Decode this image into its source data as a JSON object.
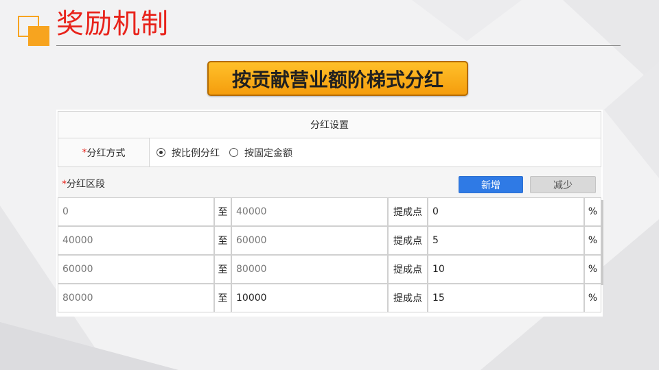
{
  "slide": {
    "title": "奖励机制",
    "banner": "按贡献营业额阶梯式分红"
  },
  "colors": {
    "title_red": "#e8231b",
    "accent_orange": "#f7a41f",
    "button_blue": "#2f7ae5",
    "button_grey": "#d9d9d9"
  },
  "form": {
    "header": "分红设置",
    "required_mark": "*",
    "mode_label": "分红方式",
    "mode_options": [
      {
        "label": "按比例分红",
        "selected": true
      },
      {
        "label": "按固定金额",
        "selected": false
      }
    ],
    "range_label": "分红区段",
    "add_button": "新增",
    "remove_button": "减少",
    "to_label": "至",
    "point_label": "提成点",
    "percent_symbol": "%",
    "rows": [
      {
        "from": "0",
        "to": "40000",
        "point": "0"
      },
      {
        "from": "40000",
        "to": "60000",
        "point": "5"
      },
      {
        "from": "60000",
        "to": "80000",
        "point": "10"
      },
      {
        "from": "80000",
        "to": "10000",
        "point": "15"
      }
    ]
  }
}
